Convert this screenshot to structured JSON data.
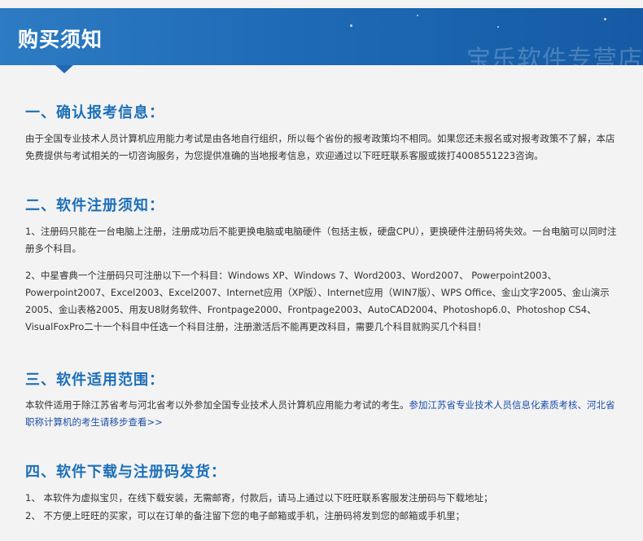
{
  "header": {
    "title": "购买须知",
    "shop_watermark": "宝乐软件专营店",
    "colors": {
      "primary": "#1f6ab6",
      "heading": "#1c6fb8",
      "link": "#1c4fa8",
      "background": "#f3f3f3"
    }
  },
  "sections": [
    {
      "title": "一、确认报考信息：",
      "paragraphs": [
        "由于全国专业技术人员计算机应用能力考试是由各地自行组织，所以每个省份的报考政策均不相同。如果您还未报名或对报考政策不了解，本店免费提供与考试相关的一切咨询服务，为您提供准确的当地报考信息，欢迎通过以下旺旺联系客服或拨打4008551223咨询。"
      ]
    },
    {
      "title": "二、软件注册须知：",
      "paragraphs": [
        "1、注册码只能在一台电脑上注册，注册成功后不能更换电脑或电脑硬件（包括主板，硬盘CPU），更换硬件注册码将失效。一台电脑可以同时注册多个科目。",
        "2、中星睿典一个注册码只可注册以下一个科目：Windows XP、Windows 7、Word2003、Word2007、 Powerpoint2003、Powerpoint2007、Excel2003、Excel2007、Internet应用（XP版）、Internet应用（WIN7版）、WPS Office、金山文字2005、金山演示2005、金山表格2005、用友U8财务软件、Frontpage2000、Frontpage2003、AutoCAD2004、Photoshop6.0、Photoshop CS4、VisualFoxPro二十一个科目中任选一个科目注册，注册激活后不能再更改科目，需要几个科目就购买几个科目！"
      ]
    },
    {
      "title": "三、软件适用范围：",
      "text": "本软件适用于除江苏省考与河北省考以外参加全国专业技术人员计算机应用能力考试的考生。",
      "link": "参加江苏省专业技术人员信息化素质考核、河北省职称计算机的考生请移步查看>>"
    },
    {
      "title": "四、软件下载与注册码发货：",
      "paragraphs": [
        "1、 本软件为虚拟宝贝，在线下载安装，无需邮寄，付款后，请马上通过以下旺旺联系客服发注册码与下载地址；",
        "2、 不方便上旺旺的买家，可以在订单的备注留下您的电子邮箱或手机，注册码将发到您的邮箱或手机里；"
      ]
    }
  ]
}
